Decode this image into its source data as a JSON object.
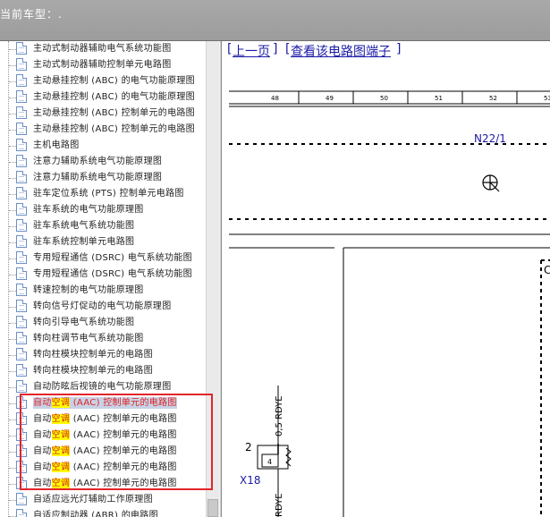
{
  "header": {
    "title": "当前车型：."
  },
  "toolbar": {
    "prev_page": "上一页",
    "view_terminals": "查看该电路图端子"
  },
  "tree": {
    "items": [
      {
        "label": "主动式制动器辅助电气系统功能图"
      },
      {
        "label": "主动式制动器辅助控制单元电路图"
      },
      {
        "label": "主动悬挂控制 (ABC) 的电气功能原理图"
      },
      {
        "label": "主动悬挂控制 (ABC) 的电气功能原理图"
      },
      {
        "label": "主动悬挂控制 (ABC) 控制单元的电路图"
      },
      {
        "label": "主动悬挂控制 (ABC) 控制单元的电路图"
      },
      {
        "label": "主机电路图"
      },
      {
        "label": "注意力辅助系统电气功能原理图"
      },
      {
        "label": "注意力辅助系统电气功能原理图"
      },
      {
        "label": "驻车定位系统 (PTS) 控制单元电路图"
      },
      {
        "label": "驻车系统的电气功能原理图"
      },
      {
        "label": "驻车系统电气系统功能图"
      },
      {
        "label": "驻车系统控制单元电路图"
      },
      {
        "label": "专用短程通信 (DSRC) 电气系统功能图"
      },
      {
        "label": "专用短程通信 (DSRC) 电气系统功能图"
      },
      {
        "label": "转速控制的电气功能原理图"
      },
      {
        "label": "转向信号灯促动的电气功能原理图"
      },
      {
        "label": "转向引导电气系统功能图"
      },
      {
        "label": "转向柱调节电气系统功能图"
      },
      {
        "label": "转向柱模块控制单元的电路图"
      },
      {
        "label": "转向柱模块控制单元的电路图"
      },
      {
        "label": "自动防眩后视镜的电气功能原理图"
      },
      {
        "pre": "自动",
        "hl": "空调",
        "post": " (AAC) 控制单元的电路图",
        "selected": true
      },
      {
        "pre": "自动",
        "hl": "空调",
        "post": " (AAC) 控制单元的电路图"
      },
      {
        "pre": "自动",
        "hl": "空调",
        "post": " (AAC) 控制单元的电路图"
      },
      {
        "pre": "自动",
        "hl": "空调",
        "post": " (AAC) 控制单元的电路图"
      },
      {
        "pre": "自动",
        "hl": "空调",
        "post": " (AAC) 控制单元的电路图"
      },
      {
        "pre": "自动",
        "hl": "空调",
        "post": " (AAC) 控制单元的电路图"
      },
      {
        "label": "自适应远光灯辅助工作原理图"
      },
      {
        "label": "自适应制动器 (ABR) 的电路图"
      }
    ]
  },
  "diagram": {
    "columns": [
      "48",
      "49",
      "50",
      "51",
      "52",
      "53"
    ],
    "component_label": "N22/1",
    "wire_label": "0,5 RDYE",
    "wire_label_2": "RDYE",
    "pin_number": "2",
    "pin_inner": "4",
    "connector_label": "X18",
    "box_label": "C"
  },
  "colors": {
    "highlight": "#ffff00",
    "selection_text": "#e02020",
    "callout_box": "#e2252b",
    "link": "#1a1aa6"
  }
}
